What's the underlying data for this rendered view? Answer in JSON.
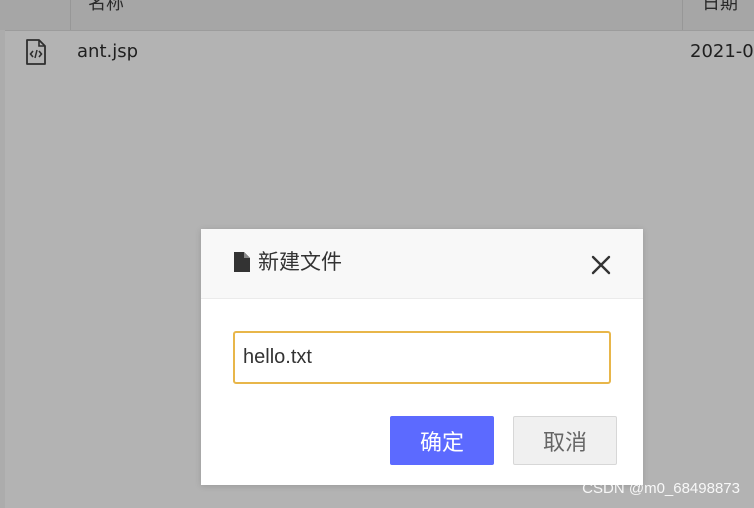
{
  "file_list": {
    "columns": {
      "name": "名称",
      "date": "日期"
    },
    "rows": [
      {
        "icon": "code-file-icon",
        "name": "ant.jsp",
        "date": "2021-0"
      }
    ]
  },
  "dialog": {
    "title_icon": "file-icon",
    "title": "新建文件",
    "close_icon": "close-icon",
    "input_value": "hello.txt",
    "confirm_label": "确定",
    "cancel_label": "取消"
  },
  "colors": {
    "confirm_button": "#5c6aff",
    "input_focus_border": "#e8b64a",
    "overlay": "#b3b3b3"
  },
  "watermark": "CSDN @m0_68498873"
}
